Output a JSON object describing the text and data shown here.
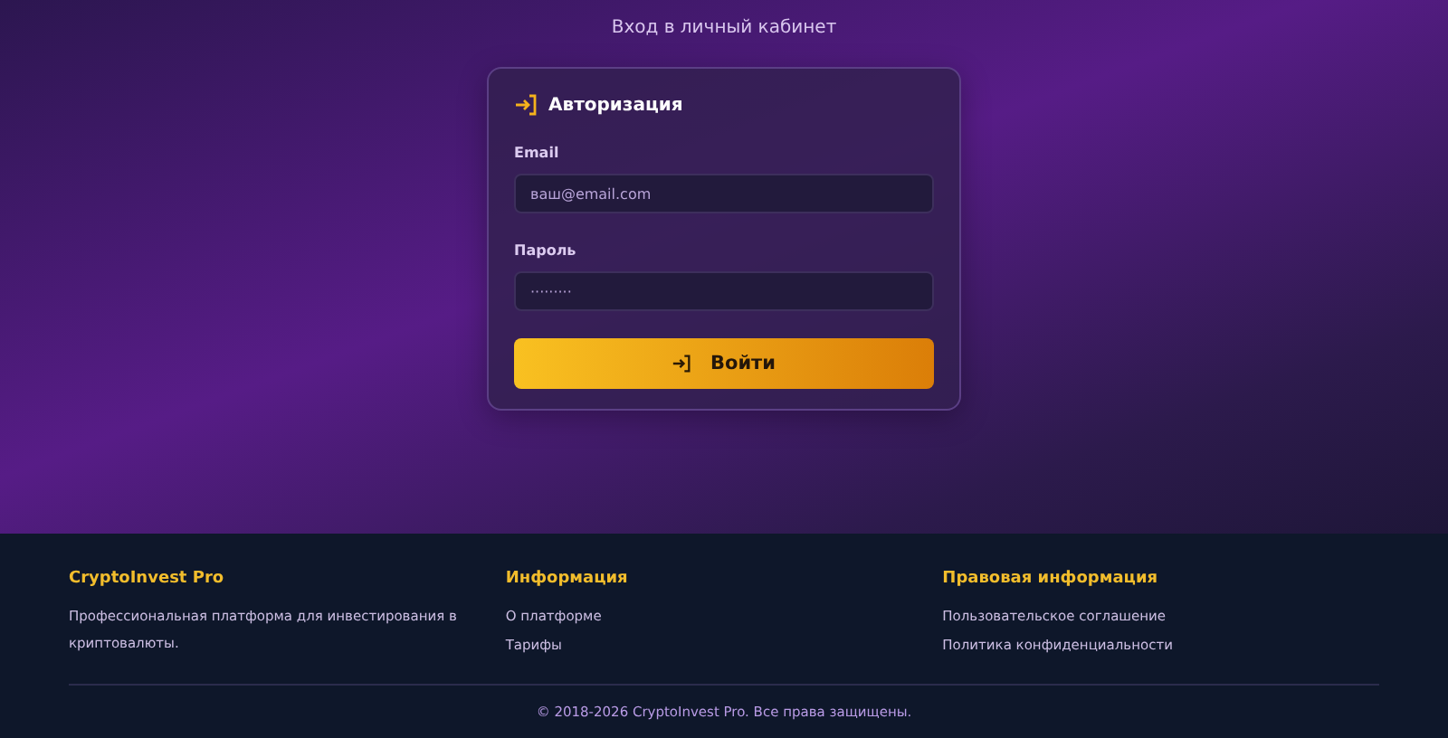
{
  "page_title": "Вход в личный кабинет",
  "login_card": {
    "title": "Авторизация",
    "fields": [
      {
        "label": "Email",
        "placeholder": "ваш@email.com"
      },
      {
        "label": "Пароль",
        "placeholder": "·········"
      }
    ],
    "submit_button": "Войти"
  },
  "footer": {
    "columns": [
      {
        "heading": "CryptoInvest Pro",
        "text": "Профессиональная платформа для инвестирования в криптовалюты."
      },
      {
        "heading": "Информация",
        "links": [
          "О платформе",
          "Тарифы"
        ]
      },
      {
        "heading": "Правовая информация",
        "links": [
          "Пользовательское соглашение",
          "Политика конфиденциальности"
        ]
      }
    ],
    "copyright": "© 2018-2026 CryptoInvest Pro. Все права защищены."
  }
}
